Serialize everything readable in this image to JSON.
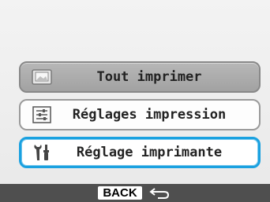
{
  "menu": {
    "items": [
      {
        "label": "Tout imprimer",
        "icon": "print-all-icon",
        "state": "disabled"
      },
      {
        "label": "Réglages impression",
        "icon": "print-settings-icon",
        "state": "normal"
      },
      {
        "label": "Réglage imprimante",
        "icon": "printer-settings-tools-icon",
        "state": "selected"
      }
    ]
  },
  "footer": {
    "back_label": "BACK",
    "back_icon": "return-arrow-icon"
  },
  "colors": {
    "selection_border": "#1aa1e0",
    "footer_bg": "#4f4f4f"
  }
}
